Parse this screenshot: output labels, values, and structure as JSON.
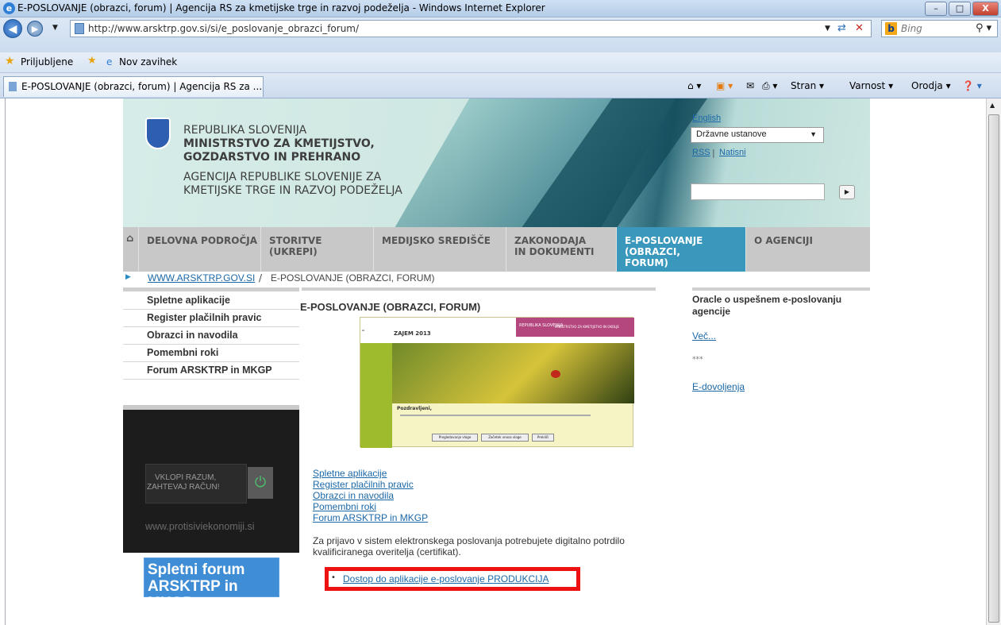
{
  "window": {
    "title": "E-POSLOVANJE (obrazci, forum) | Agencija RS za kmetijske trge in razvoj podeželja - Windows Internet Explorer",
    "minimize": "–",
    "maximize": "□",
    "close": "X"
  },
  "address": {
    "url": "http://www.arsktrp.gov.si/si/e_poslovanje_obrazci_forum/",
    "search_engine": "Bing"
  },
  "favorites": {
    "label": "Priljubljene",
    "new_tab": "Nov zavihek"
  },
  "tab": {
    "title": "E-POSLOVANJE (obrazci, forum) | Agencija RS za ..."
  },
  "commandbar": {
    "page": "Stran ▾",
    "safety": "Varnost ▾",
    "tools": "Orodja ▾"
  },
  "header": {
    "line1": "REPUBLIKA SLOVENIJA",
    "line2": "MINISTRSTVO ZA KMETIJSTVO,",
    "line3": "GOZDARSTVO IN PREHRANO",
    "line4": "AGENCIJA REPUBLIKE SLOVENIJE ZA",
    "line5": "KMETIJSKE TRGE IN RAZVOJ PODEŽELJA",
    "lang_link": "English",
    "select_value": "Državne ustanove",
    "rss": "RSS",
    "sep": "|",
    "print": "Natisni"
  },
  "nav": {
    "items": [
      "DELOVNA PODROČJA",
      "STORITVE (UKREPI)",
      "MEDIJSKO SREDIŠČE",
      "ZAKONODAJA IN DOKUMENTI",
      "E-POSLOVANJE (OBRAZCI, FORUM)",
      "O AGENCIJI"
    ]
  },
  "breadcrumb": {
    "home": "WWW.ARSKTRP.GOV.SI",
    "sep": "/",
    "current": "E-POSLOVANJE (OBRAZCI, FORUM)"
  },
  "sidebar": {
    "items": [
      "Spletne aplikacije",
      "Register plačilnih pravic",
      "Obrazci in navodila",
      "Pomembni roki",
      "Forum ARSKTRP in MKGP"
    ]
  },
  "promo": {
    "line1": "VKLOPI RAZUM,",
    "line2": "ZAHTEVAJ RAČUN!",
    "url": "www.protisiviekonomiji.si"
  },
  "forum_banner": {
    "line1": "Spletni forum",
    "line2": "ARSKTRP in MKGP"
  },
  "main": {
    "heading": "E-POSLOVANJE (OBRAZCI, FORUM)",
    "shot_title": "ZAJEM 2013",
    "shot_brand": "REPUBLIKA SLOVENIJA",
    "shot_ministry": "MINISTRSTVO ZA KMETIJSTVO IN OKOLJE",
    "shot_welcome": "Pozdravljeni,",
    "shot_btn1": "Pregledovanje vloge",
    "shot_btn2": "Začetek vnosa vloge",
    "shot_btn3": "Prekliči",
    "links": [
      "Spletne aplikacije",
      "Register plačilnih pravic",
      "Obrazci in navodila",
      "Pomembni roki",
      "Forum ARSKTRP in MKGP"
    ],
    "info1": "Za prijavo v sistem elektronskega poslovanja potrebujete digitalno potrdilo",
    "info2": "kvalificiranega overitelja (certifikat).",
    "production_link": "Dostop do aplikacije e-poslovanje PRODUKCIJA"
  },
  "right": {
    "title1": "Oracle o uspešnem e-poslovanju",
    "title2": "agencije",
    "more": "Več...",
    "stars": "***",
    "link2": "E-dovoljenja"
  }
}
